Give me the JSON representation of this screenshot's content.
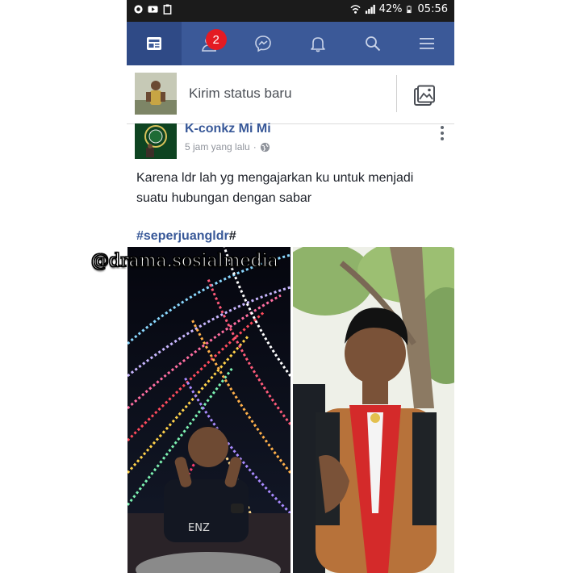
{
  "status_bar": {
    "battery": "42%",
    "time": "05:56",
    "left_icons": [
      "vpn-icon",
      "youtube-icon",
      "clipboard-icon"
    ],
    "right_icons": [
      "wifi-icon",
      "signal-icon",
      "battery-icon"
    ]
  },
  "nav": {
    "tabs": [
      {
        "name": "news-feed",
        "icon": "news-feed-icon"
      },
      {
        "name": "friend-requests",
        "icon": "friends-icon",
        "badge": "2"
      },
      {
        "name": "messenger",
        "icon": "messenger-icon"
      },
      {
        "name": "notifications",
        "icon": "bell-icon"
      },
      {
        "name": "search",
        "icon": "search-icon"
      },
      {
        "name": "menu",
        "icon": "hamburger-icon"
      }
    ],
    "active_tab": "news-feed",
    "color": "#3b5998"
  },
  "composer": {
    "placeholder": "Kirim status baru",
    "photo_icon": "photo-icon"
  },
  "post": {
    "author": "K-conkz Mi Mi",
    "time": "5 jam yang lalu",
    "separator": "·",
    "privacy_icon": "globe-icon",
    "text": "Karena ldr lah yg mengajarkan ku untuk menjadi suatu hubungan dengan sabar",
    "hashtag": "#seperjuangldr",
    "hashtag_suffix": "#",
    "link_color": "#385898"
  },
  "watermark": "@drama.sosialmedia"
}
